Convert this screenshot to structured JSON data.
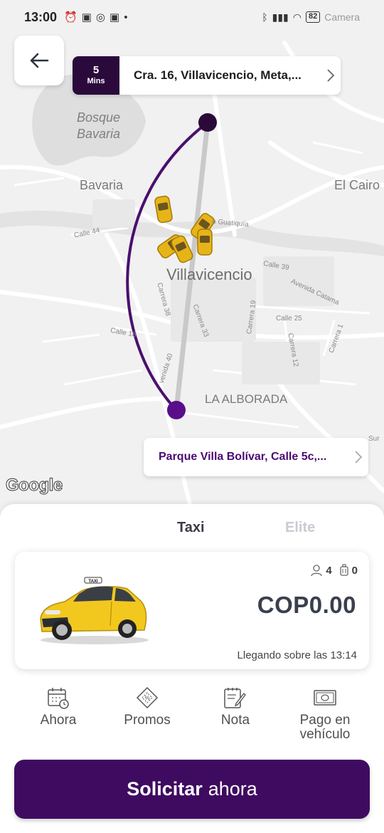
{
  "status_bar": {
    "time": "13:00",
    "battery": "82",
    "camera_text": "Camera"
  },
  "map": {
    "labels": {
      "bosque_bavaria_1": "Bosque",
      "bosque_bavaria_2": "Bavaria",
      "bavaria": "Bavaria",
      "el_cairo": "El Cairo",
      "villavicencio": "Villavicencio",
      "la_alborada": "LA ALBORADA",
      "calle_44": "Calle 44",
      "guatiquia": "o Guatiquía",
      "calle_39": "Calle 39",
      "avenida_catama": "Avenida Catama",
      "carrera_38": "Carrera 38",
      "carrera_33": "Carrera 33",
      "carrera_19": "Carrera 19",
      "calle_25": "Calle 25",
      "carrera_12": "Carrera 12",
      "carrera_1": "Carrera 1",
      "calle_18": "Calle 18",
      "avenida_40": "venida 40",
      "sur": "Sur"
    },
    "google_logo": "Google"
  },
  "pickup": {
    "eta_value": "5",
    "eta_unit": "Mins",
    "address": "Cra. 16, Villavicencio, Meta,..."
  },
  "dropoff": {
    "address": "Parque Villa Bolívar, Calle 5c,..."
  },
  "tabs": [
    {
      "label": "Taxi",
      "active": true
    },
    {
      "label": "Elite",
      "active": false
    }
  ],
  "vehicle": {
    "passengers": "4",
    "luggage": "0",
    "price": "COP0.00",
    "arrival": "Llegando sobre las 13:14",
    "roof_sign": "TAXI"
  },
  "options": [
    {
      "label": "Ahora",
      "icon": "calendar-clock-icon"
    },
    {
      "label": "Promos",
      "icon": "ticket-icon"
    },
    {
      "label": "Nota",
      "icon": "note-pencil-icon"
    },
    {
      "label_line1": "Pago en",
      "label_line2": "vehículo",
      "icon": "cash-icon"
    }
  ],
  "request_button": {
    "bold": "Solicitar",
    "normal": "ahora"
  },
  "colors": {
    "brand_purple": "#3f0b60",
    "eta_bg": "#2a0a3b",
    "dropoff_text": "#4b0a73",
    "taxi_yellow": "#f2c81e"
  }
}
